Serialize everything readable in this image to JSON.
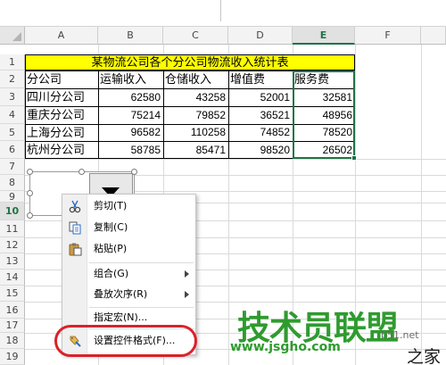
{
  "columns": [
    "A",
    "B",
    "C",
    "D",
    "E",
    "F"
  ],
  "active_column": "E",
  "rows": [
    "1",
    "2",
    "3",
    "4",
    "5",
    "6",
    "7",
    "8",
    "9",
    "10",
    "11",
    "12",
    "13",
    "14",
    "15",
    "16",
    "17",
    "18",
    "19"
  ],
  "active_row": "10",
  "sheet": {
    "title": "某物流公司各个分公司物流收入统计表",
    "headers": [
      "分公司",
      "运输收入",
      "仓储收入",
      "增值费",
      "服务费"
    ],
    "data": [
      [
        "四川分公司",
        "62580",
        "43258",
        "52001",
        "32581"
      ],
      [
        "重庆分公司",
        "75214",
        "79852",
        "36521",
        "48956"
      ],
      [
        "上海分公司",
        "96582",
        "110258",
        "74852",
        "78520"
      ],
      [
        "杭州分公司",
        "58785",
        "85471",
        "98520",
        "26502"
      ]
    ]
  },
  "context_menu": {
    "items": [
      {
        "icon": "scissors-icon",
        "label": "剪切(T)"
      },
      {
        "icon": "copy-icon",
        "label": "复制(C)"
      },
      {
        "icon": "paste-icon",
        "label": "粘贴(P)"
      },
      {
        "icon": "",
        "label": "组合(G)",
        "submenu": true
      },
      {
        "icon": "",
        "label": "叠放次序(R)",
        "submenu": true
      },
      {
        "icon": "",
        "label": "指定宏(N)..."
      },
      {
        "icon": "format-control-icon",
        "label": "设置控件格式(F)..."
      }
    ]
  },
  "watermark": {
    "brand": "技术员联盟",
    "url": "www.jsgho.com",
    "small": "jb51.net",
    "zhi": "之家"
  },
  "colors": {
    "title_fill": "#ffff00",
    "selection": "#217346",
    "highlight_oval": "#d9222a",
    "watermark": "#2f9b2f"
  }
}
